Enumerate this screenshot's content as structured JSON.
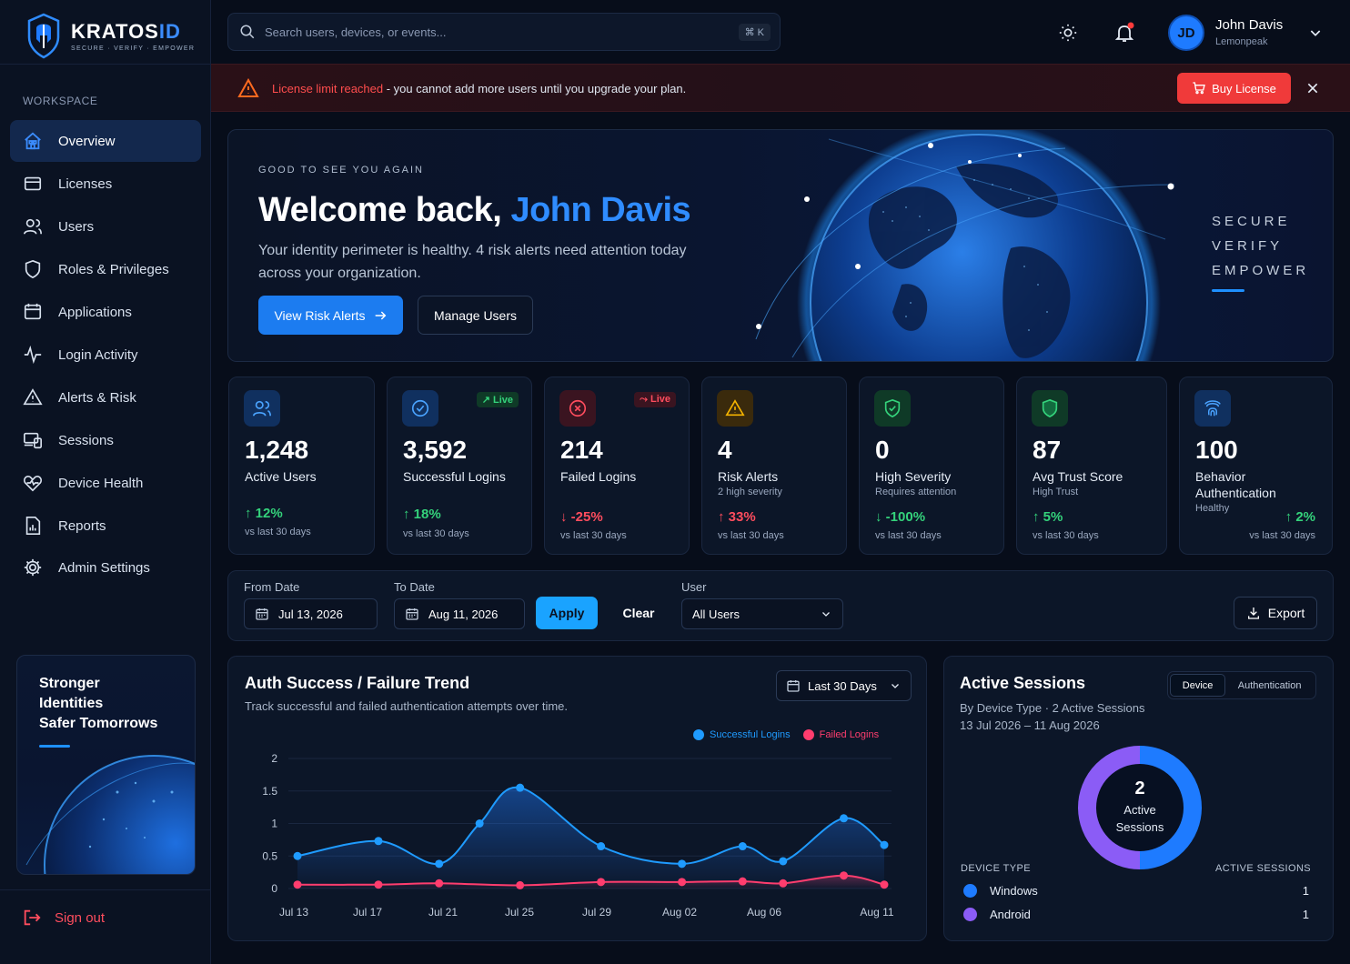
{
  "brand": {
    "name_main": "KRATOS",
    "name_accent": "ID",
    "tagline": "SECURE · VERIFY · EMPOWER"
  },
  "sidebar": {
    "section_title": "WORKSPACE",
    "items": [
      {
        "label": "Overview",
        "icon": "home-icon"
      },
      {
        "label": "Licenses",
        "icon": "card-icon"
      },
      {
        "label": "Users",
        "icon": "users-icon"
      },
      {
        "label": "Roles & Privileges",
        "icon": "shield-icon"
      },
      {
        "label": "Applications",
        "icon": "window-icon"
      },
      {
        "label": "Login Activity",
        "icon": "activity-icon"
      },
      {
        "label": "Alerts & Risk",
        "icon": "warning-icon"
      },
      {
        "label": "Sessions",
        "icon": "devices-icon"
      },
      {
        "label": "Device Health",
        "icon": "heart-icon"
      },
      {
        "label": "Reports",
        "icon": "report-icon"
      },
      {
        "label": "Admin Settings",
        "icon": "gear-icon"
      }
    ],
    "active_index": 0,
    "promo_line1": "Stronger",
    "promo_line2": "Identities",
    "promo_line3": "Safer Tomorrows",
    "signout": "Sign out"
  },
  "topbar": {
    "search_placeholder": "Search users, devices, or events...",
    "shortcut": "⌘ K",
    "user_initials": "JD",
    "user_name": "John Davis",
    "user_org": "Lemonpeak"
  },
  "banner": {
    "highlight": "License limit reached",
    "message": " - you cannot add more users until you upgrade your plan.",
    "button": "Buy License"
  },
  "hero": {
    "kicker": "GOOD TO SEE YOU AGAIN",
    "title_prefix": "Welcome back, ",
    "title_name": "John Davis",
    "subtitle": "Your identity perimeter is healthy. 4 risk alerts need attention today across your organization.",
    "primary_button": "View Risk Alerts",
    "secondary_button": "Manage Users",
    "tag1": "SECURE",
    "tag2": "VERIFY",
    "tag3": "EMPOWER"
  },
  "kpis": [
    {
      "value": "1,248",
      "label": "Active Users",
      "sub": "",
      "delta": "12%",
      "dir": "up",
      "vs": "vs last 30 days",
      "icon": "users-icon",
      "color": "#2f8cff"
    },
    {
      "value": "3,592",
      "label": "Successful Logins",
      "sub": "",
      "delta": "18%",
      "dir": "up",
      "vs": "vs last 30 days",
      "icon": "check-circle-icon",
      "color": "#2f8cff",
      "live": "Live"
    },
    {
      "value": "214",
      "label": "Failed Logins",
      "sub": "",
      "delta": "-25%",
      "dir": "down",
      "vs": "vs last 30 days",
      "icon": "x-circle-icon",
      "color": "#ff4d5e",
      "live": "Live"
    },
    {
      "value": "4",
      "label": "Risk Alerts",
      "sub": "2 high severity",
      "delta": "33%",
      "dir": "up-red",
      "vs": "vs last 30 days",
      "icon": "warning-icon",
      "color": "#f5b400"
    },
    {
      "value": "0",
      "label": "High Severity",
      "sub": "Requires attention",
      "delta": "-100%",
      "dir": "down-green",
      "vs": "vs last 30 days",
      "icon": "shield-check-icon",
      "color": "#34d27b"
    },
    {
      "value": "87",
      "label": "Avg Trust Score",
      "sub": "High Trust",
      "delta": "5%",
      "dir": "up",
      "vs": "vs last 30 days",
      "icon": "shield-icon",
      "color": "#34d27b"
    },
    {
      "value": "100",
      "label_line1": "Behavior",
      "label_line2": "Authentication",
      "sub": "Healthy",
      "delta": "2%",
      "dir": "up",
      "vs": "vs last 30 days",
      "icon": "fingerprint-icon",
      "color": "#2f8cff"
    }
  ],
  "filters": {
    "from_label": "From Date",
    "from_value": "Jul 13, 2026",
    "to_label": "To Date",
    "to_value": "Aug 11, 2026",
    "apply": "Apply",
    "clear": "Clear",
    "user_label": "User",
    "user_value": "All Users",
    "export": "Export"
  },
  "trend": {
    "title": "Auth Success / Failure Trend",
    "subtitle": "Track successful and failed authentication attempts over time.",
    "range": "Last 30 Days"
  },
  "chart_data": {
    "type": "line",
    "x_tick_labels": [
      "Jul 13",
      "Jul 17",
      "Jul 21",
      "Jul 25",
      "Jul 29",
      "Aug 02",
      "Aug 06",
      "Aug 11"
    ],
    "y_ticks": [
      "0",
      "0.5",
      "1",
      "1.5",
      "2"
    ],
    "ylim": [
      0,
      2
    ],
    "series": [
      {
        "name": "Successful Logins",
        "color": "#1f9bff",
        "points": [
          [
            "Jul 13",
            0.5
          ],
          [
            "Jul 17",
            0.73
          ],
          [
            "Jul 20",
            0.38
          ],
          [
            "Jul 22",
            1.0
          ],
          [
            "Jul 24",
            1.55
          ],
          [
            "Jul 28",
            0.65
          ],
          [
            "Aug 01",
            0.38
          ],
          [
            "Aug 04",
            0.65
          ],
          [
            "Aug 06",
            0.42
          ],
          [
            "Aug 09",
            1.08
          ],
          [
            "Aug 11",
            0.67
          ]
        ]
      },
      {
        "name": "Failed Logins",
        "color": "#ff3d6e",
        "points": [
          [
            "Jul 13",
            0.06
          ],
          [
            "Jul 17",
            0.06
          ],
          [
            "Jul 20",
            0.08
          ],
          [
            "Jul 24",
            0.05
          ],
          [
            "Jul 28",
            0.1
          ],
          [
            "Aug 01",
            0.1
          ],
          [
            "Aug 04",
            0.11
          ],
          [
            "Aug 06",
            0.08
          ],
          [
            "Aug 09",
            0.2
          ],
          [
            "Aug 11",
            0.06
          ]
        ]
      }
    ]
  },
  "sessions": {
    "title": "Active Sessions",
    "tab_on": "Device",
    "tab_off": "Authentication",
    "subtitle": "By Device Type · 2 Active Sessions",
    "date_range": "13 Jul 2026 – 11 Aug 2026",
    "center_value": "2",
    "center_label1": "Active",
    "center_label2": "Sessions",
    "col_left": "DEVICE TYPE",
    "col_right": "ACTIVE SESSIONS",
    "rows": [
      {
        "label": "Windows",
        "value": "1",
        "color": "#1e7bff"
      },
      {
        "label": "Android",
        "value": "1",
        "color": "#8b5cf6"
      }
    ]
  }
}
